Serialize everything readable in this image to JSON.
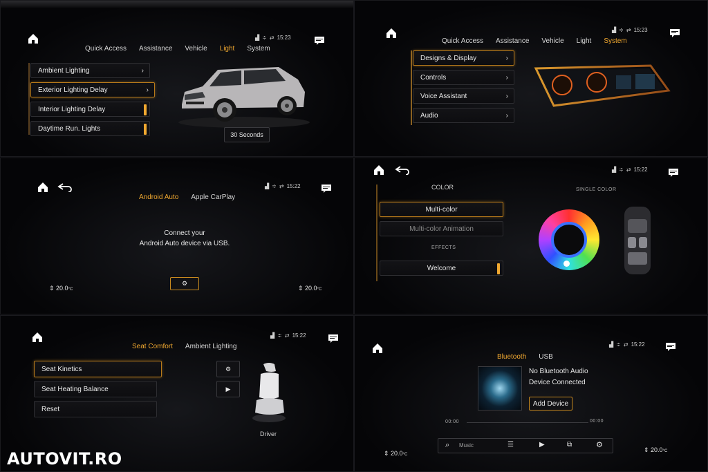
{
  "watermark": "AUTOVIT.RO",
  "colors": {
    "accent": "#f0a830",
    "background": "#050507"
  },
  "p1": {
    "time": "15:23",
    "tabs": [
      "Quick Access",
      "Assistance",
      "Vehicle",
      "Light",
      "System"
    ],
    "active_tab": "Light",
    "items": [
      "Ambient Lighting",
      "Exterior Lighting Delay",
      "Interior Lighting Delay",
      "Daytime Run. Lights"
    ],
    "value_button": "30 Seconds"
  },
  "p2": {
    "time": "15:23",
    "tabs": [
      "Quick Access",
      "Assistance",
      "Vehicle",
      "Light",
      "System"
    ],
    "active_tab": "System",
    "items": [
      "Designs & Display",
      "Controls",
      "Voice Assistant",
      "Audio"
    ]
  },
  "p3": {
    "time": "15:22",
    "tabs": [
      "Android Auto",
      "Apple CarPlay"
    ],
    "active_tab": "Android Auto",
    "message_line1": "Connect your",
    "message_line2": "Android Auto device via USB.",
    "temp_left": "20.0",
    "temp_right": "20.0",
    "temp_unit": "°C"
  },
  "p4": {
    "time": "15:22",
    "color_heading": "COLOR",
    "single_color": "SINGLE COLOR",
    "multi_color": "Multi-color",
    "multi_color_animation": "Multi-color Animation",
    "effects_heading": "EFFECTS",
    "welcome": "Welcome"
  },
  "p5": {
    "time": "15:22",
    "tabs": [
      "Seat Comfort",
      "Ambient Lighting"
    ],
    "active_tab": "Seat Comfort",
    "items": [
      "Seat Kinetics",
      "Seat Heating Balance",
      "Reset"
    ],
    "seat_label": "Driver"
  },
  "p6": {
    "time": "15:22",
    "tabs": [
      "Bluetooth",
      "USB"
    ],
    "active_tab": "Bluetooth",
    "status_line1": "No Bluetooth Audio",
    "status_line2": "Device Connected",
    "add_device": "Add Device",
    "time_start": "00:00",
    "time_end": "00:00",
    "search_label": "Music",
    "temp_left": "20.0",
    "temp_right": "20.0",
    "temp_unit": "°C"
  }
}
